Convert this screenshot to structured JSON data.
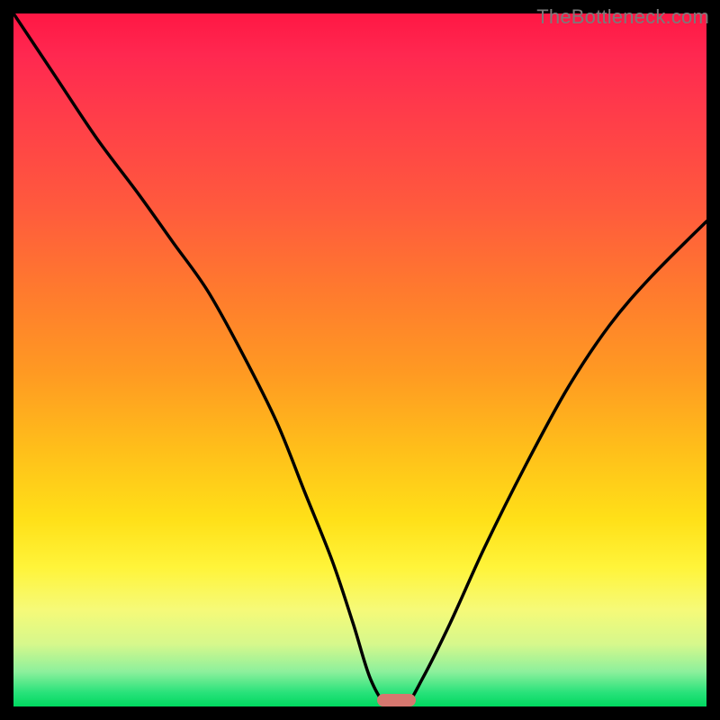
{
  "watermark": "TheBottleneck.com",
  "colors": {
    "frame_bg": "#000000",
    "curve_stroke": "#000000",
    "marker": "#d6776f",
    "gradient_top": "#ff1744",
    "gradient_bottom": "#00d860"
  },
  "chart_data": {
    "type": "line",
    "title": "",
    "xlabel": "",
    "ylabel": "",
    "xlim": [
      0,
      100
    ],
    "ylim": [
      0,
      100
    ],
    "grid": false,
    "series": [
      {
        "name": "bottleneck-curve",
        "x": [
          0,
          6,
          12,
          18,
          23,
          28,
          33,
          38,
          42,
          46,
          49,
          51.5,
          54,
          56.5,
          59,
          63,
          68,
          74,
          80,
          86,
          92,
          100
        ],
        "y": [
          100,
          91,
          82,
          74,
          67,
          60,
          51,
          41,
          31,
          21,
          12,
          4,
          0,
          0,
          4,
          12,
          23,
          35,
          46,
          55,
          62,
          70
        ]
      }
    ],
    "annotations": [
      {
        "name": "optimal-zone-marker",
        "x_start": 52.5,
        "x_end": 58,
        "y": 0
      }
    ],
    "background": "vertical-gradient red→orange→yellow→green"
  }
}
